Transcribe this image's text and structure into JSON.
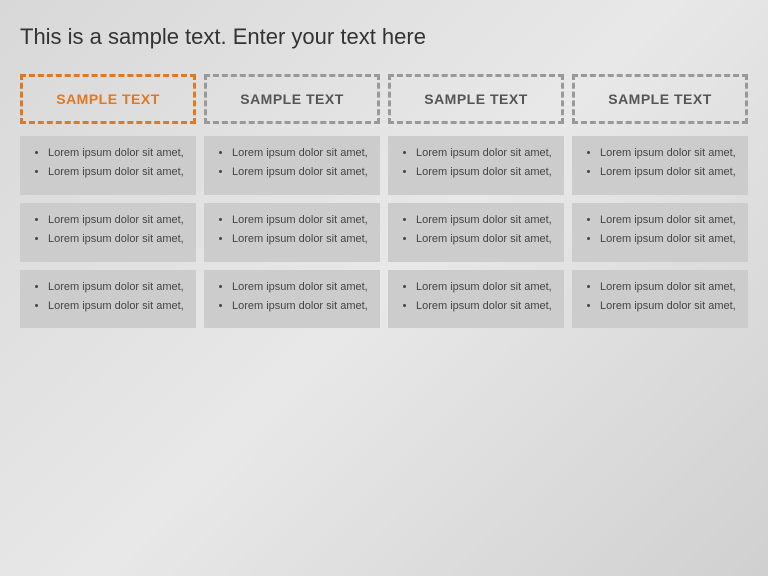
{
  "title": "This is a sample text. Enter your text here",
  "colors": {
    "accent": "#e07820",
    "header_inactive": "#999999",
    "block_bg": "#cccccc",
    "text_dark": "#444444"
  },
  "columns": [
    {
      "id": "col1",
      "header": "SAMPLE TEXT",
      "active": true,
      "rows": [
        {
          "items": [
            "Lorem ipsum dolor sit amet,",
            "Lorem ipsum dolor sit amet,"
          ]
        },
        {
          "items": [
            "Lorem ipsum dolor sit amet,",
            "Lorem ipsum dolor sit amet,"
          ]
        },
        {
          "items": [
            "Lorem ipsum dolor sit amet,",
            "Lorem ipsum dolor sit amet,"
          ]
        }
      ]
    },
    {
      "id": "col2",
      "header": "SAMPLE TEXT",
      "active": false,
      "rows": [
        {
          "items": [
            "Lorem ipsum dolor sit amet,",
            "Lorem ipsum dolor sit amet,"
          ]
        },
        {
          "items": [
            "Lorem ipsum dolor sit amet,",
            "Lorem ipsum dolor sit amet,"
          ]
        },
        {
          "items": [
            "Lorem ipsum dolor sit amet,",
            "Lorem ipsum dolor sit amet,"
          ]
        }
      ]
    },
    {
      "id": "col3",
      "header": "SAMPLE TEXT",
      "active": false,
      "rows": [
        {
          "items": [
            "Lorem ipsum dolor sit amet,",
            "Lorem ipsum dolor sit amet,"
          ]
        },
        {
          "items": [
            "Lorem ipsum dolor sit amet,",
            "Lorem ipsum dolor sit amet,"
          ]
        },
        {
          "items": [
            "Lorem ipsum dolor sit amet,",
            "Lorem ipsum dolor sit amet,"
          ]
        }
      ]
    },
    {
      "id": "col4",
      "header": "SAMPLE TEXT",
      "active": false,
      "rows": [
        {
          "items": [
            "Lorem ipsum dolor sit amet,",
            "Lorem ipsum dolor sit amet,"
          ]
        },
        {
          "items": [
            "Lorem ipsum dolor sit amet,",
            "Lorem ipsum dolor sit amet,"
          ]
        },
        {
          "items": [
            "Lorem ipsum dolor sit amet,",
            "Lorem ipsum dolor sit amet,"
          ]
        }
      ]
    }
  ]
}
